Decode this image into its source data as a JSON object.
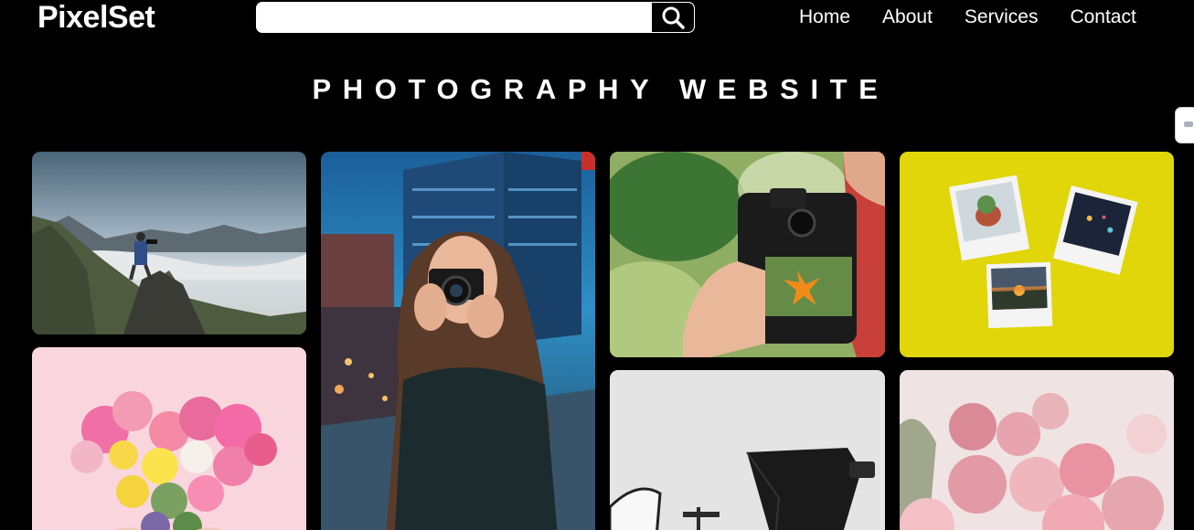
{
  "header": {
    "logo": "PixelSet",
    "search": {
      "value": "",
      "placeholder": ""
    },
    "nav": [
      {
        "label": "Home"
      },
      {
        "label": "About"
      },
      {
        "label": "Services"
      },
      {
        "label": "Contact"
      }
    ]
  },
  "main": {
    "title": "PHOTOGRAPHY WEBSITE"
  },
  "icons": {
    "search": "search-icon",
    "side_tab": "feedback-tab-icon"
  },
  "colors": {
    "background": "#000000",
    "text": "#ffffff",
    "search_button": "#000000"
  }
}
